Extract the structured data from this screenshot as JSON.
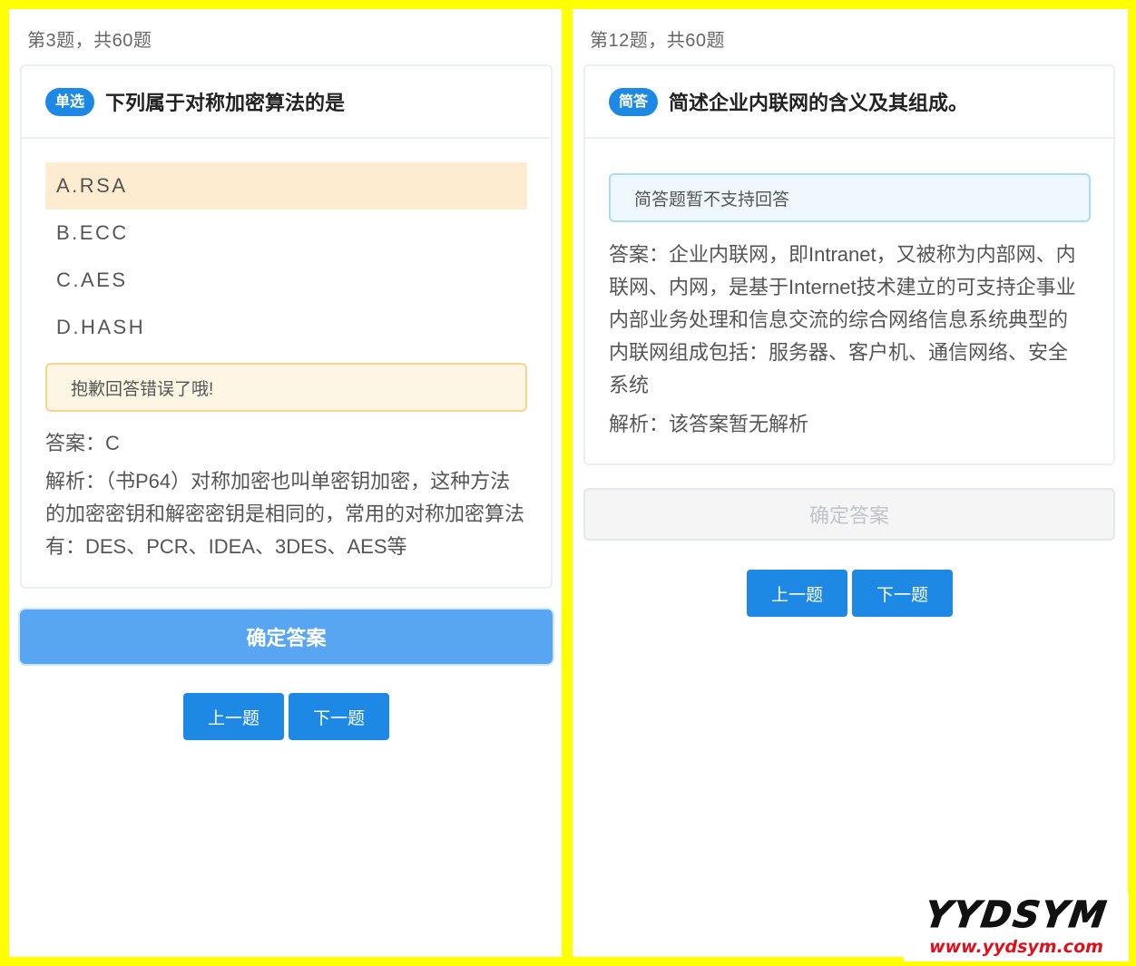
{
  "left": {
    "counter": "第3题，共60题",
    "tag": "单选",
    "question": "下列属于对称加密算法的是",
    "options": [
      "A.RSA",
      "B.ECC",
      "C.AES",
      "D.HASH"
    ],
    "selected_option": "A.RSA",
    "feedback": "抱歉回答错误了哦!",
    "answer": "答案：C",
    "analysis": "解析：（书P64）对称加密也叫单密钥加密，这种方法的加密密钥和解密密钥是相同的，常用的对称加密算法有：DES、PCR、IDEA、3DES、AES等",
    "confirm_label": "确定答案",
    "prev_label": "上一题",
    "next_label": "下一题"
  },
  "right": {
    "counter": "第12题，共60题",
    "tag": "简答",
    "question": "简述企业内联网的含义及其组成。",
    "notice": "简答题暂不支持回答",
    "answer": "答案：企业内联网，即Intranet，又被称为内部网、内联网、内网，是基于Internet技术建立的可支持企事业内部业务处理和信息交流的综合网络信息系统典型的内联网组成包括：服务器、客户机、通信网络、安全系统",
    "analysis": "解析：该答案暂无解析",
    "confirm_label": "确定答案",
    "confirm_disabled": true,
    "prev_label": "上一题",
    "next_label": "下一题"
  },
  "watermark": {
    "logo": "YYDSYM",
    "url": "www.yydsym.com"
  },
  "colors": {
    "frame": "#ffff00",
    "primary": "#1e88e5",
    "selected_option_bg": "#fdecd0",
    "warning_border": "#f8d58c",
    "info_border": "#a9dcf9"
  }
}
